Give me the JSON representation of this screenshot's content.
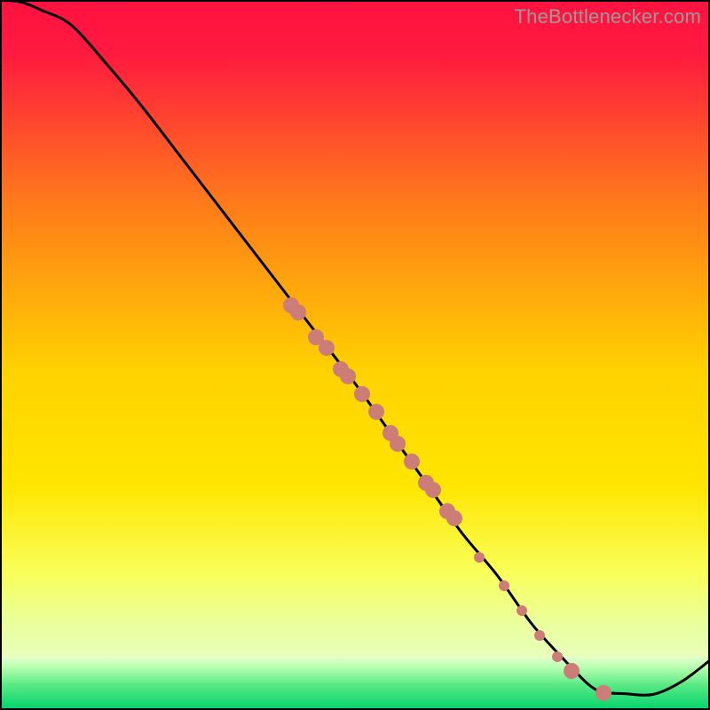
{
  "watermark": {
    "text": "TheBottlenecker.com"
  },
  "chart_data": {
    "type": "line",
    "title": "",
    "xlabel": "",
    "ylabel": "",
    "xlim": [
      0,
      100
    ],
    "ylim": [
      0,
      100
    ],
    "grid": false,
    "legend": false,
    "background_gradient": {
      "top": "#ff1a3f",
      "mid_upper": "#ff7a1a",
      "mid": "#ffe600",
      "mid_lower": "#f6ff66",
      "green_start": "#ccff99",
      "green_end": "#00e676"
    },
    "series": [
      {
        "name": "curve",
        "stroke": "#000000",
        "x": [
          0,
          3,
          6,
          10,
          15,
          20,
          25,
          30,
          35,
          40,
          45,
          50,
          55,
          60,
          65,
          70,
          75,
          80,
          83,
          85,
          88,
          92,
          96,
          100
        ],
        "y": [
          100,
          99.7,
          98.5,
          96.5,
          91,
          85,
          78.5,
          72,
          65.5,
          59,
          52.5,
          46,
          39,
          32,
          25,
          19,
          12,
          6.5,
          3.5,
          2.5,
          2.3,
          2.2,
          4.0,
          7.0
        ]
      }
    ],
    "scatter": {
      "name": "markers",
      "fill": "#cd7d78",
      "radius_main": 9,
      "radius_small": 6,
      "points": [
        {
          "x": 41.0,
          "y": 57.0,
          "r": "main"
        },
        {
          "x": 42.0,
          "y": 56.0,
          "r": "main"
        },
        {
          "x": 44.5,
          "y": 52.5,
          "r": "main"
        },
        {
          "x": 46.0,
          "y": 51.0,
          "r": "main"
        },
        {
          "x": 48.0,
          "y": 48.0,
          "r": "main"
        },
        {
          "x": 49.0,
          "y": 47.0,
          "r": "main"
        },
        {
          "x": 51.0,
          "y": 44.5,
          "r": "main"
        },
        {
          "x": 53.0,
          "y": 42.0,
          "r": "main"
        },
        {
          "x": 55.0,
          "y": 39.0,
          "r": "main"
        },
        {
          "x": 56.0,
          "y": 37.5,
          "r": "main"
        },
        {
          "x": 58.0,
          "y": 35.0,
          "r": "main"
        },
        {
          "x": 60.0,
          "y": 32.0,
          "r": "main"
        },
        {
          "x": 61.0,
          "y": 31.0,
          "r": "main"
        },
        {
          "x": 63.0,
          "y": 28.0,
          "r": "main"
        },
        {
          "x": 64.0,
          "y": 27.0,
          "r": "main"
        },
        {
          "x": 67.5,
          "y": 21.5,
          "r": "small"
        },
        {
          "x": 71.0,
          "y": 17.5,
          "r": "small"
        },
        {
          "x": 73.5,
          "y": 14.0,
          "r": "small"
        },
        {
          "x": 76.0,
          "y": 10.5,
          "r": "small"
        },
        {
          "x": 78.5,
          "y": 7.5,
          "r": "small"
        },
        {
          "x": 80.5,
          "y": 5.5,
          "r": "main"
        },
        {
          "x": 85.0,
          "y": 2.4,
          "r": "main"
        }
      ]
    }
  }
}
